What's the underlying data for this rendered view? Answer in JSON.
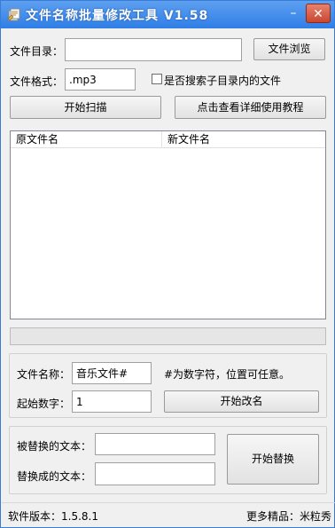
{
  "window": {
    "title": "文件名称批量修改工具 V1.58"
  },
  "form": {
    "dir_label": "文件目录：",
    "dir_value": "",
    "browse_label": "文件浏览",
    "format_label": "文件格式：",
    "format_value": ".mp3",
    "subdir_label": "是否搜索子目录内的文件",
    "subdir_checked": false,
    "scan_label": "开始扫描",
    "tutorial_label": "点击查看详细使用教程"
  },
  "list": {
    "columns": [
      "原文件名",
      "新文件名"
    ],
    "rows": []
  },
  "progress": {
    "fraction": 0
  },
  "rename": {
    "name_label": "文件名称：",
    "name_value": "音乐文件#",
    "hint": "#为数字符，位置可任意。",
    "start_num_label": "起始数字：",
    "start_num_value": "1",
    "rename_button": "开始改名"
  },
  "replace": {
    "from_label": "被替换的文本：",
    "from_value": "",
    "to_label": "替换成的文本：",
    "to_value": "",
    "replace_button": "开始替换"
  },
  "status": {
    "version": "软件版本：1.5.8.1",
    "more": "更多精品：米粒秀"
  },
  "colors": {
    "title_bar": "#2f7ee6",
    "close_button": "#c9452e",
    "window_bg": "#f0f0f0"
  }
}
